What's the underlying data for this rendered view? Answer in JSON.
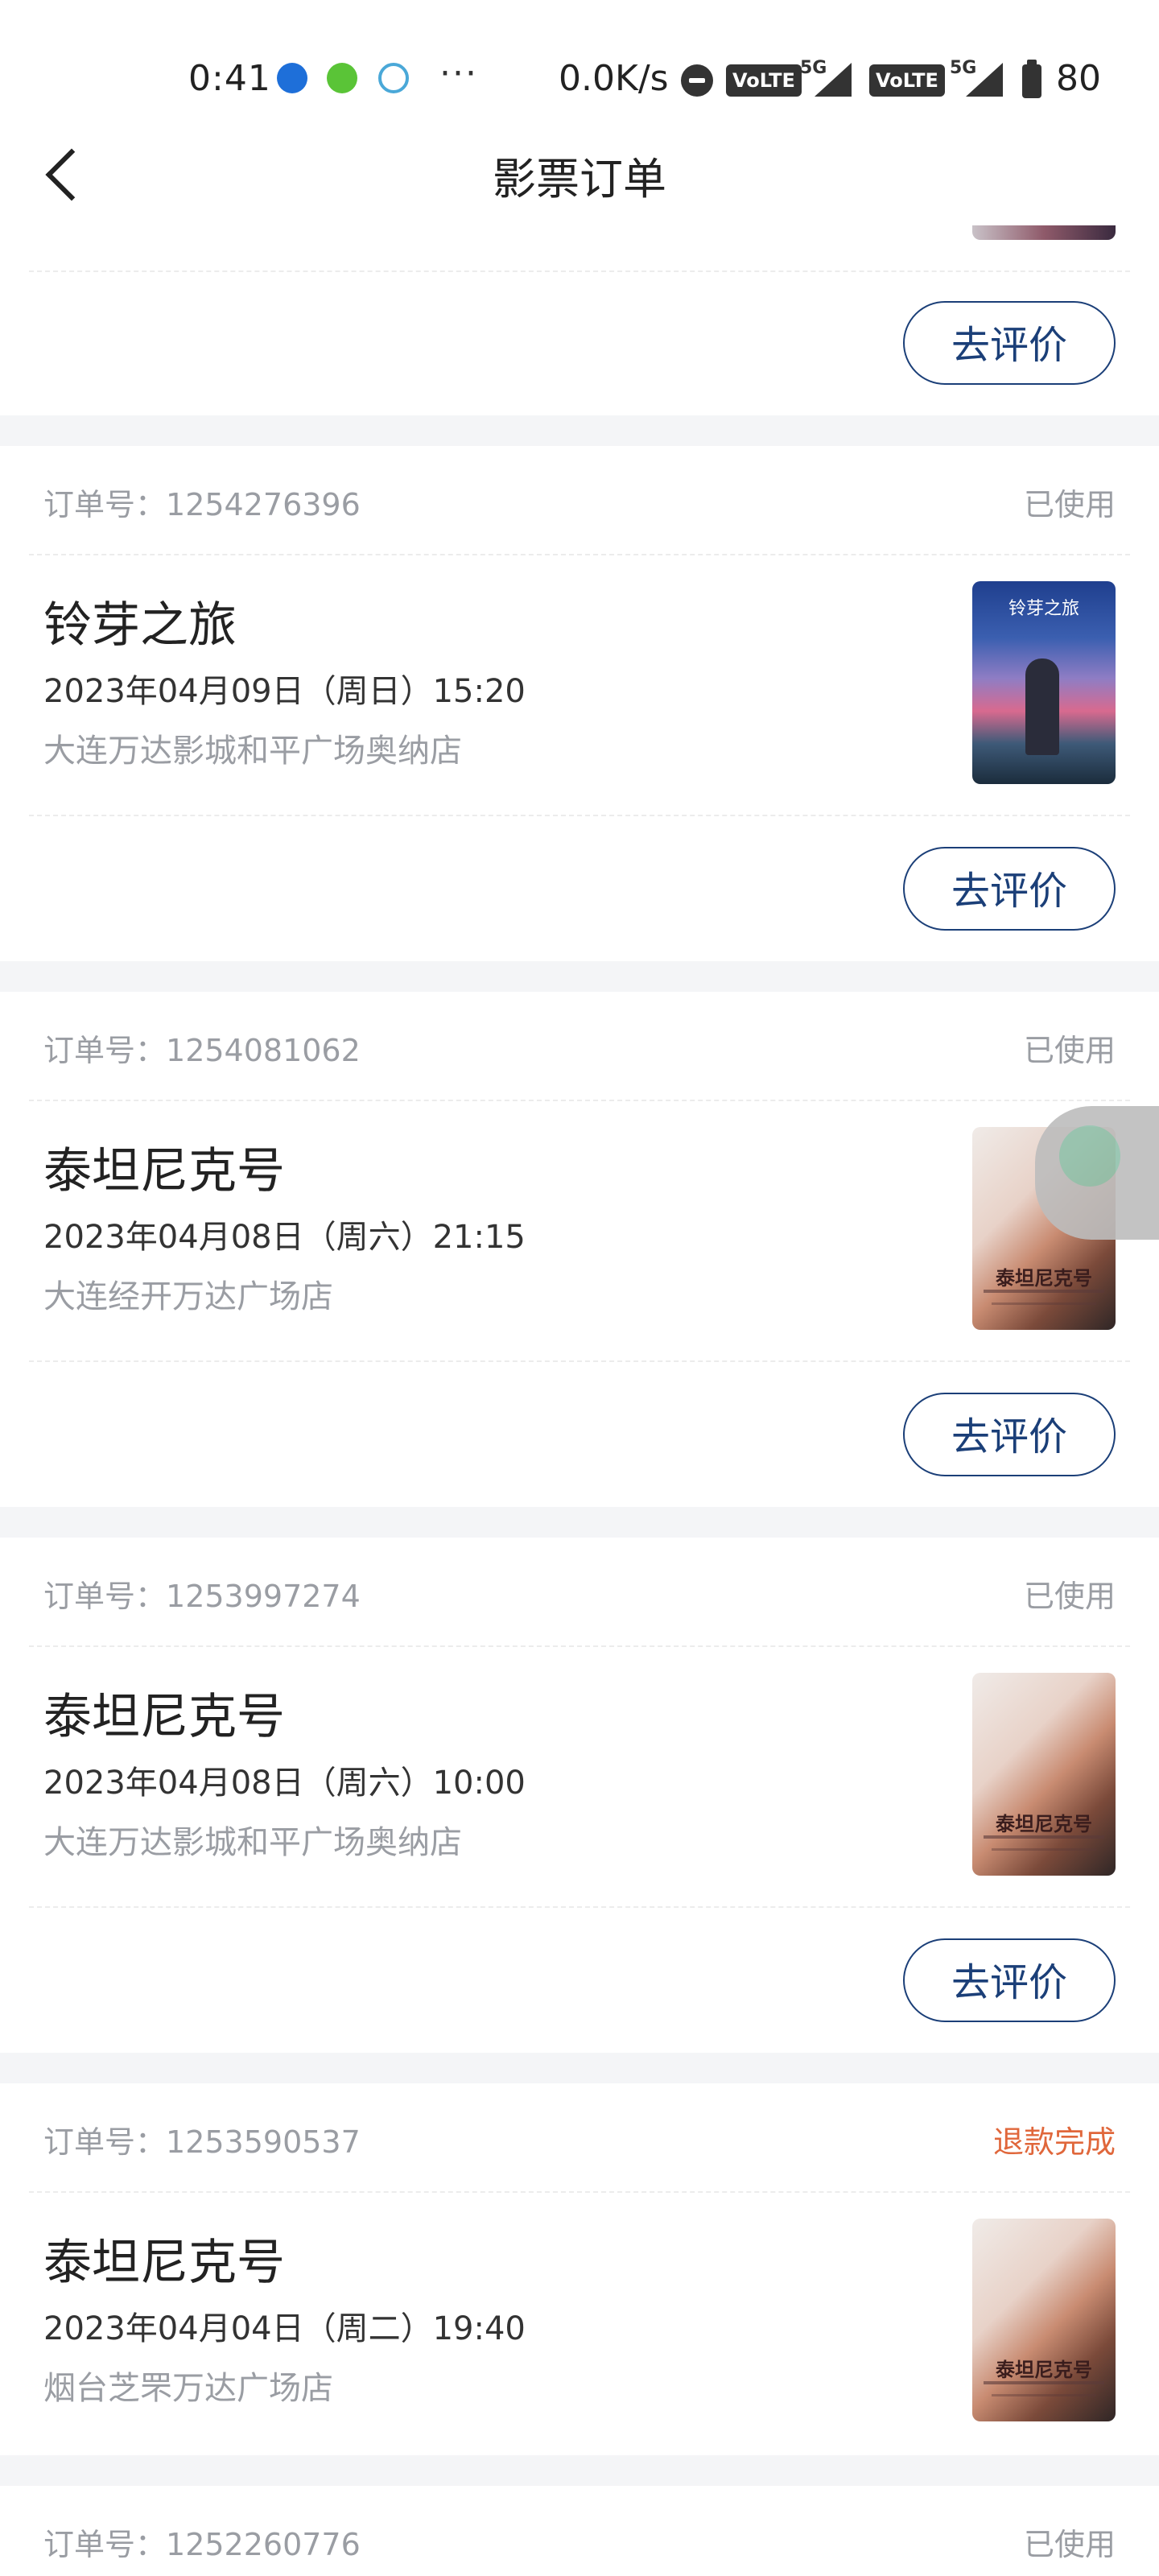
{
  "status_bar": {
    "time": "0:41",
    "dots": "···",
    "speed": "0.0K/s",
    "volte": "VoLTE",
    "net": "5G",
    "battery": "80"
  },
  "nav": {
    "title": "影票订单",
    "back_icon": "chevron-left-icon"
  },
  "eval_label": "去评价",
  "order_label": "订单号：",
  "colors": {
    "accent": "#1b3f78",
    "refund": "#e0673b",
    "muted": "#9a9da3"
  },
  "orders": [
    {
      "order_no": "1254276396",
      "status": "已使用",
      "title": "铃芽之旅",
      "time": "2023年04月09日（周日）15:20",
      "cinema": "大连万达影城和平广场奥纳店",
      "poster_text": "铃芽之旅"
    },
    {
      "order_no": "1254081062",
      "status": "已使用",
      "title": "泰坦尼克号",
      "time": "2023年04月08日（周六）21:15",
      "cinema": "大连经开万达广场店",
      "poster_text": "泰坦尼克号"
    },
    {
      "order_no": "1253997274",
      "status": "已使用",
      "title": "泰坦尼克号",
      "time": "2023年04月08日（周六）10:00",
      "cinema": "大连万达影城和平广场奥纳店",
      "poster_text": "泰坦尼克号"
    },
    {
      "order_no": "1253590537",
      "status": "退款完成",
      "title": "泰坦尼克号",
      "time": "2023年04月04日（周二）19:40",
      "cinema": "烟台芝罘万达广场店",
      "poster_text": "泰坦尼克号"
    },
    {
      "order_no": "1252260776",
      "status": "已使用"
    }
  ]
}
